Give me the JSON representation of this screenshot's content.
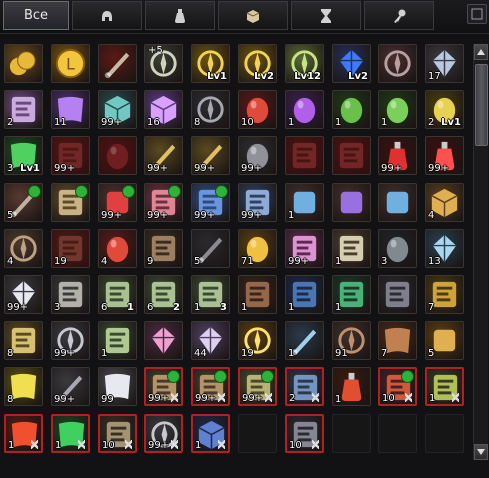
{
  "tabs": [
    {
      "label": "Все",
      "icon": "all",
      "active": true
    },
    {
      "label": "",
      "icon": "helmet-icon"
    },
    {
      "label": "",
      "icon": "potion-icon"
    },
    {
      "label": "",
      "icon": "box-icon"
    },
    {
      "label": "",
      "icon": "hourglass-icon"
    },
    {
      "label": "",
      "icon": "key-icon"
    }
  ],
  "rows": [
    [
      {
        "icon": "gold-coins",
        "count": "",
        "bg": "#6b4a1c",
        "fg": "#e8b83a"
      },
      {
        "icon": "l-coin",
        "count": "",
        "bg": "#7a5510",
        "fg": "#f3c53d"
      },
      {
        "icon": "claws",
        "count": "",
        "bg": "#5a1a14",
        "fg": "#c9b9a0"
      },
      {
        "icon": "armor",
        "count": "",
        "plus": "+5",
        "bg": "#3a3f34",
        "fg": "#cfd3c0"
      },
      {
        "icon": "gold-rune",
        "count": "",
        "level": "Lv1",
        "bg": "#6a5410",
        "fg": "#f1d35a"
      },
      {
        "icon": "gold-rune",
        "count": "",
        "level": "Lv2",
        "bg": "#6a5410",
        "fg": "#f1d35a"
      },
      {
        "icon": "gold-rune-blue",
        "count": "",
        "level": "Lv12",
        "bg": "#5a6a30",
        "fg": "#c6e28a"
      },
      {
        "icon": "blue-gem",
        "count": "",
        "level": "Lv2",
        "bg": "#25305a",
        "fg": "#3f79ff"
      },
      {
        "icon": "dark-brooch",
        "count": "",
        "bg": "#4a2e2e",
        "fg": "#b8a0a0"
      },
      {
        "icon": "crystal-shard",
        "count": "17",
        "bg": "#3a3a40",
        "fg": "#b8c8e0"
      }
    ],
    [
      {
        "icon": "purple-scroll",
        "count": "2",
        "bg": "#6a4a7a",
        "fg": "#d9b8ee"
      },
      {
        "icon": "purple-wings",
        "count": "11",
        "bg": "#4a3070",
        "fg": "#b580f0"
      },
      {
        "icon": "teal-cube",
        "count": "99+",
        "bg": "#2a4a50",
        "fg": "#70c8c0"
      },
      {
        "icon": "violet-cube",
        "count": "16",
        "bg": "#5a3a80",
        "fg": "#d8a0ff"
      },
      {
        "icon": "grey-rune",
        "count": "8",
        "bg": "#2c2c30",
        "fg": "#a8a8b0"
      },
      {
        "icon": "red-stone",
        "count": "10",
        "bg": "#5a1818",
        "fg": "#e04a3a"
      },
      {
        "icon": "purple-orb",
        "count": "1",
        "bg": "#3a2050",
        "fg": "#b060e8"
      },
      {
        "icon": "green-egg",
        "count": "1",
        "bg": "#1f3a18",
        "fg": "#6ac04a"
      },
      {
        "icon": "green-egg",
        "count": "1",
        "bg": "#1f3a18",
        "fg": "#7ad05a"
      },
      {
        "icon": "yellow-egg",
        "count": "2",
        "level": "Lv1",
        "bg": "#4a4010",
        "fg": "#e8d050"
      }
    ],
    [
      {
        "icon": "green-leaf",
        "count": "3",
        "level": "Lv1",
        "bg": "#1a4a20",
        "fg": "#50d060"
      },
      {
        "icon": "red-scroll",
        "count": "99+",
        "dim": true,
        "bg": "#5a2020",
        "fg": "#a04040"
      },
      {
        "icon": "red-sphere",
        "count": "",
        "dim": true,
        "bg": "#4a1a1a",
        "fg": "#903030"
      },
      {
        "icon": "gold-rod",
        "count": "99+",
        "bg": "#5a4a20",
        "fg": "#e0c060"
      },
      {
        "icon": "gold-rod",
        "count": "99+",
        "bg": "#5a4a20",
        "fg": "#e0c060"
      },
      {
        "icon": "grey-ore",
        "count": "99+",
        "bg": "#2e2e30",
        "fg": "#909098"
      },
      {
        "icon": "red-scroll",
        "count": "",
        "dim": true,
        "bg": "#4a1a1a",
        "fg": "#a04040"
      },
      {
        "icon": "red-scroll",
        "count": "",
        "dim": true,
        "bg": "#4a1a1a",
        "fg": "#a04040"
      },
      {
        "icon": "red-potion",
        "count": "99+",
        "bg": "#3a1010",
        "fg": "#e03030"
      },
      {
        "icon": "red-flask",
        "count": "99+",
        "bg": "#3a1010",
        "fg": "#ff5050"
      }
    ],
    [
      {
        "icon": "dagger",
        "count": "5",
        "sync": true,
        "bg": "#5a3a30",
        "fg": "#c0b0a0"
      },
      {
        "icon": "exp-scroll",
        "count": "",
        "sync": true,
        "bg": "#5a4a2a",
        "fg": "#d8c090"
      },
      {
        "icon": "red-cross",
        "count": "99+",
        "sync": true,
        "bg": "#4a3030",
        "fg": "#e04040"
      },
      {
        "icon": "pink-scroll",
        "count": "99+",
        "sync": true,
        "bg": "#6a3040",
        "fg": "#f090a0"
      },
      {
        "icon": "blue-scroll",
        "count": "99+",
        "sync": true,
        "bg": "#304a7a",
        "fg": "#70a0f0"
      },
      {
        "icon": "blue-tablet",
        "count": "99+",
        "bg": "#304060",
        "fg": "#9ab8e8"
      },
      {
        "icon": "horn-blue",
        "count": "1",
        "bg": "#40302a",
        "fg": "#70b0e0"
      },
      {
        "icon": "horn-purple",
        "count": "",
        "bg": "#40302a",
        "fg": "#9a70e0"
      },
      {
        "icon": "horn-blue",
        "count": "",
        "bg": "#40302a",
        "fg": "#70b0e0"
      },
      {
        "icon": "treasure-chest",
        "count": "4",
        "bg": "#5a4020",
        "fg": "#e0b050"
      }
    ],
    [
      {
        "icon": "winged-emblem",
        "count": "4",
        "bg": "#4a3a30",
        "fg": "#c0a080"
      },
      {
        "icon": "book",
        "count": "19",
        "dim": true,
        "bg": "#4a2a20",
        "fg": "#a06050"
      },
      {
        "icon": "red-compass",
        "count": "4",
        "bg": "#5a1a1a",
        "fg": "#e04a3a"
      },
      {
        "icon": "brown-scroll",
        "count": "9",
        "bg": "#3a2a20",
        "fg": "#a88a6a"
      },
      {
        "icon": "dark-blade",
        "count": "5",
        "bg": "#2a2a2e",
        "fg": "#8a8a90"
      },
      {
        "icon": "gold-disk",
        "count": "71",
        "bg": "#5a4010",
        "fg": "#f0c040"
      },
      {
        "icon": "pink-ticket",
        "count": "99+",
        "bg": "#5a2a50",
        "fg": "#f0a0e0"
      },
      {
        "icon": "ivory-scroll",
        "count": "1",
        "bg": "#4a4030",
        "fg": "#e8e0c0"
      },
      {
        "icon": "dark-rock",
        "count": "3",
        "bg": "#202428",
        "fg": "#808890"
      },
      {
        "icon": "diamond",
        "count": "13",
        "bg": "#2a4050",
        "fg": "#a8d8f0"
      }
    ],
    [
      {
        "icon": "white-gem",
        "count": "99+",
        "bg": "#3a3a3e",
        "fg": "#e8e8f0"
      },
      {
        "icon": "grey-paper",
        "count": "3",
        "bg": "#3a3a38",
        "fg": "#c0c0b8"
      },
      {
        "icon": "green-paper",
        "count": "6",
        "level": "1",
        "bg": "#3a4a30",
        "fg": "#b8d0a0"
      },
      {
        "icon": "green-paper",
        "count": "6",
        "level": "2",
        "bg": "#3a4a30",
        "fg": "#b8d0a0"
      },
      {
        "icon": "green-paper",
        "count": "1",
        "level": "3",
        "bg": "#3a4a30",
        "fg": "#b8d0a0"
      },
      {
        "icon": "leather-book",
        "count": "1",
        "bg": "#3a2418",
        "fg": "#a07050"
      },
      {
        "icon": "blue-book",
        "count": "1",
        "bg": "#1a2a4a",
        "fg": "#5080c0"
      },
      {
        "icon": "green-book",
        "count": "1",
        "bg": "#1a3a2a",
        "fg": "#50c080"
      },
      {
        "icon": "grey-book",
        "count": "",
        "bg": "#2a2a30",
        "fg": "#8a8a98"
      },
      {
        "icon": "gold-book",
        "count": "7",
        "bg": "#4a3a10",
        "fg": "#e0b040"
      }
    ],
    [
      {
        "icon": "star-scroll",
        "count": "8",
        "bg": "#5a4a20",
        "fg": "#e8d080"
      },
      {
        "icon": "spiral",
        "count": "99+",
        "bg": "#3a3a3e",
        "fg": "#c8c8d0"
      },
      {
        "icon": "scroll-mark",
        "count": "1",
        "bg": "#3a4a30",
        "fg": "#c0d8a0"
      },
      {
        "icon": "pink-crystal",
        "count": "",
        "bg": "#4a2a40",
        "fg": "#f0a0d0"
      },
      {
        "icon": "crystal-box",
        "count": "44",
        "bg": "#504060",
        "fg": "#e0d0f0"
      },
      {
        "icon": "golden-burst",
        "count": "19",
        "bg": "#5a4010",
        "fg": "#ffe070"
      },
      {
        "icon": "icy-blade",
        "count": "1",
        "bg": "#2a3a4a",
        "fg": "#a0d0f0"
      },
      {
        "icon": "rune-set",
        "count": "91",
        "bg": "#40302a",
        "fg": "#c09070"
      },
      {
        "icon": "brown-leather",
        "count": "7",
        "bg": "#4a2a18",
        "fg": "#c08050"
      },
      {
        "icon": "coin-bag",
        "count": "5",
        "bg": "#5a4010",
        "fg": "#e0b050"
      }
    ],
    [
      {
        "icon": "yellow-cloth",
        "count": "8",
        "bg": "#5a5010",
        "fg": "#f0e050"
      },
      {
        "icon": "hammer",
        "count": "99+",
        "bg": "#3a3a3e",
        "fg": "#a8a8b0"
      },
      {
        "icon": "white-cloth",
        "count": "99",
        "bg": "#4a4a50",
        "fg": "#e8e8f0"
      },
      {
        "icon": "exp-scroll",
        "count": "99+",
        "sync": true,
        "red": true,
        "hourglass": true,
        "bg": "#4a3a2a",
        "fg": "#c0a070"
      },
      {
        "icon": "exp-scroll",
        "count": "99+",
        "sync": true,
        "red": true,
        "hourglass": true,
        "bg": "#4a3a2a",
        "fg": "#c0a070"
      },
      {
        "icon": "exp-scroll",
        "count": "99+",
        "sync": true,
        "red": true,
        "hourglass": true,
        "bg": "#4a4a2a",
        "fg": "#c8c080"
      },
      {
        "icon": "blue-crystal-scroll",
        "count": "2",
        "red": true,
        "hourglass": true,
        "bg": "#2a3a4a",
        "fg": "#80a0d0"
      },
      {
        "icon": "red-potion",
        "count": "1",
        "bg": "#3a1a10",
        "fg": "#e05030"
      },
      {
        "icon": "red-ticket",
        "count": "10",
        "sync": true,
        "red": true,
        "hourglass": true,
        "bg": "#4a2020",
        "fg": "#e06040"
      },
      {
        "icon": "green-ticket",
        "count": "1",
        "red": true,
        "hourglass": true,
        "bg": "#3a3a20",
        "fg": "#c0d060"
      }
    ],
    [
      {
        "icon": "red-flag",
        "count": "1",
        "red": true,
        "hourglass": true,
        "bg": "#5a1a10",
        "fg": "#f05030"
      },
      {
        "icon": "green-flag",
        "count": "1",
        "red": true,
        "hourglass": true,
        "bg": "#1a4a20",
        "fg": "#40d060"
      },
      {
        "icon": "old-scroll",
        "count": "10",
        "red": true,
        "hourglass": true,
        "bg": "#3a3020",
        "fg": "#b0a080"
      },
      {
        "icon": "spiral",
        "count": "99+",
        "red": true,
        "hourglass": true,
        "bg": "#3a3a3e",
        "fg": "#c8c8d0"
      },
      {
        "icon": "blue-hex",
        "count": "1",
        "red": true,
        "hourglass": true,
        "bg": "#20284a",
        "fg": "#6080d0"
      },
      {
        "icon": "empty",
        "count": "",
        "bg": "",
        "fg": ""
      },
      {
        "icon": "dark-tablet",
        "count": "10",
        "red": true,
        "hourglass": true,
        "bg": "#2a2a30",
        "fg": "#9090a0"
      },
      {
        "icon": "empty",
        "count": "",
        "bg": "",
        "fg": ""
      },
      {
        "icon": "empty",
        "count": "",
        "bg": "",
        "fg": ""
      },
      {
        "icon": "empty",
        "count": "",
        "bg": "",
        "fg": ""
      }
    ]
  ],
  "extra_row_count": "1",
  "extra": {
    "a1": "1",
    "a2": "1",
    "a4": "1",
    "lv": "Lv1"
  }
}
